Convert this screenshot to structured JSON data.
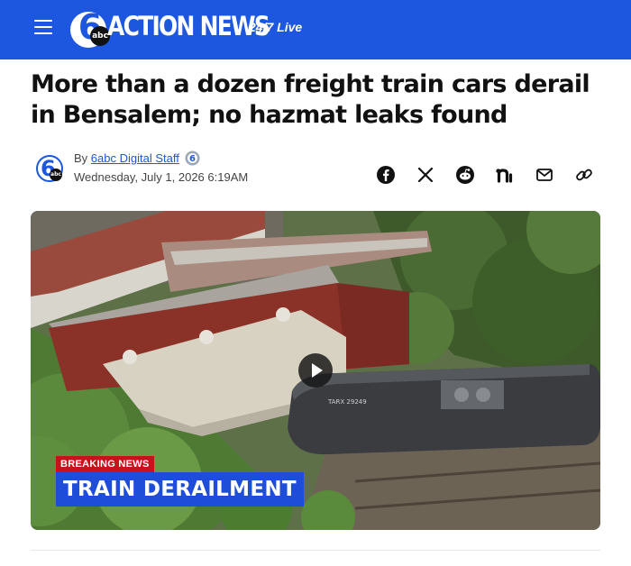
{
  "header": {
    "brand_name": "ACTION NEWS",
    "logo_number": "6",
    "logo_badge": "abc",
    "live_label": "24/7 Live",
    "brand_color": "#1d57e0"
  },
  "article": {
    "headline": "More than a dozen freight train cars derail in Bensalem; no hazmat leaks found",
    "byline_prefix": "By",
    "author": "6abc Digital Staff",
    "date": "Wednesday, July 1, 2026 6:19AM"
  },
  "share_icons": [
    "facebook-icon",
    "x-icon",
    "reddit-icon",
    "nextdoor-icon",
    "email-icon",
    "link-icon"
  ],
  "media": {
    "breaking_label": "BREAKING NEWS",
    "lower_third": "TRAIN DERAILMENT",
    "tank_car_marking": "TARX 29249",
    "breaking_color": "#c7111c",
    "lower_third_color": "#1e4dd9"
  }
}
